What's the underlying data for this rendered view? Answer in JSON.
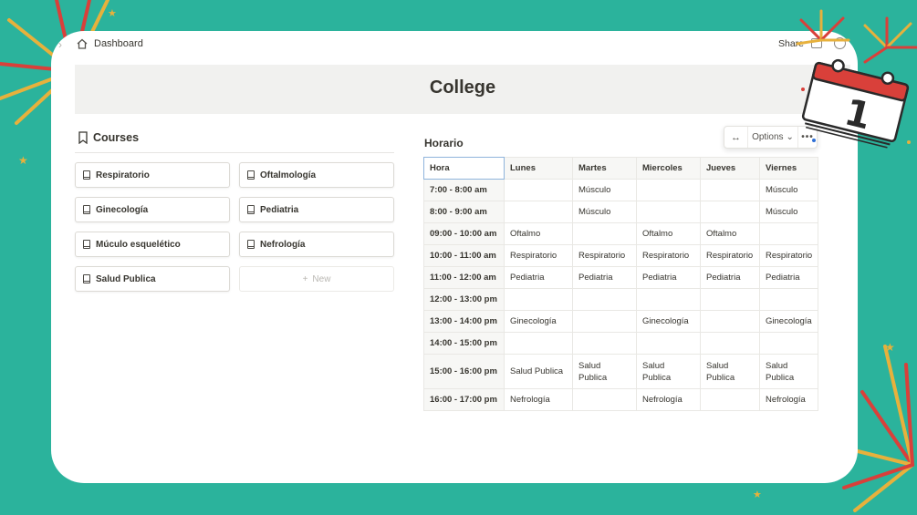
{
  "topbar": {
    "breadcrumb": "Dashboard",
    "share": "Share"
  },
  "page": {
    "title": "College"
  },
  "courses": {
    "heading": "Courses",
    "items": [
      "Respiratorio",
      "Oftalmología",
      "Ginecología",
      "Pediatria",
      "Múculo esquelético",
      "Nefrología",
      "Salud Publica"
    ],
    "new_label": "New"
  },
  "schedule": {
    "title": "Horario",
    "toolbar": {
      "swap": "↔",
      "options": "Options",
      "more": "•••"
    },
    "columns": [
      "Hora",
      "Lunes",
      "Martes",
      "Miercoles",
      "Jueves",
      "Viernes"
    ],
    "rows": [
      [
        "7:00 - 8:00 am",
        "",
        "Músculo",
        "",
        "",
        "Músculo"
      ],
      [
        "8:00 - 9:00 am",
        "",
        "Músculo",
        "",
        "",
        "Músculo"
      ],
      [
        "09:00 - 10:00 am",
        "Oftalmo",
        "",
        "Oftalmo",
        "Oftalmo",
        ""
      ],
      [
        "10:00 - 11:00 am",
        "Respiratorio",
        "Respiratorio",
        "Respiratorio",
        "Respiratorio",
        "Respiratorio"
      ],
      [
        "11:00 - 12:00 am",
        "Pediatria",
        "Pediatria",
        "Pediatria",
        "Pediatria",
        "Pediatria"
      ],
      [
        "12:00 - 13:00 pm",
        "",
        "",
        "",
        "",
        ""
      ],
      [
        "13:00 - 14:00 pm",
        "Ginecología",
        "",
        "Ginecología",
        "",
        "Ginecología"
      ],
      [
        "14:00 - 15:00 pm",
        "",
        "",
        "",
        "",
        ""
      ],
      [
        "15:00 - 16:00 pm",
        "Salud Publica",
        "Salud Publica",
        "Salud Publica",
        "Salud Publica",
        "Salud Publica"
      ],
      [
        "16:00 - 17:00 pm",
        "Nefrología",
        "",
        "Nefrología",
        "",
        "Nefrología"
      ]
    ]
  },
  "calendar_sticker": {
    "day": "1"
  },
  "colors": {
    "background": "#2bb39c",
    "card": "#ffffff",
    "header_band": "#f1f1ef",
    "accent_red": "#d9403a",
    "accent_gold": "#e7b13c"
  }
}
